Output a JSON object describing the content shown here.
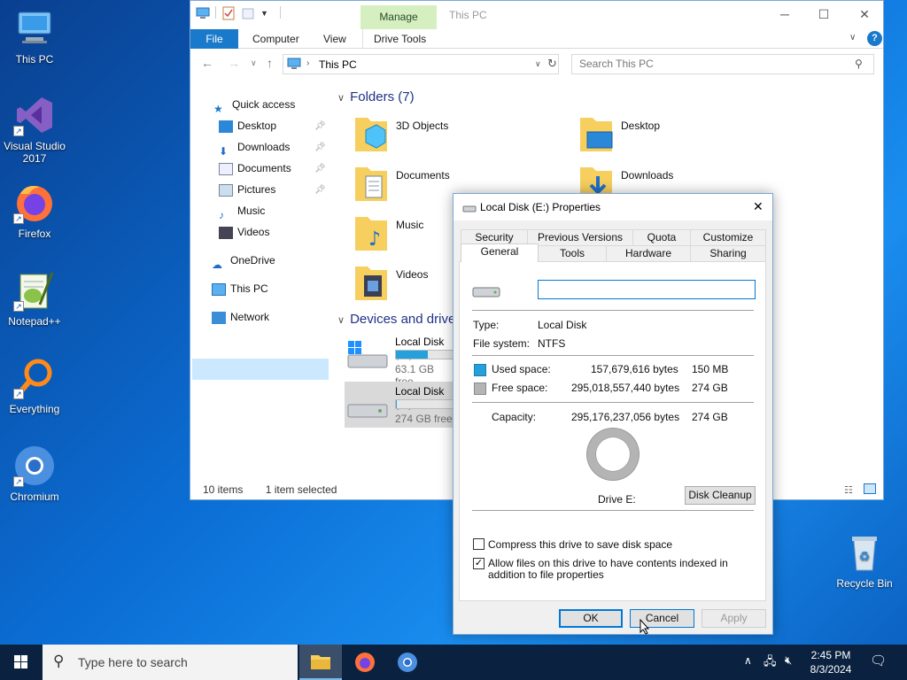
{
  "desktop": {
    "icons": [
      {
        "label": "This PC"
      },
      {
        "label": "Visual Studio 2017"
      },
      {
        "label": "Firefox"
      },
      {
        "label": "Notepad++"
      },
      {
        "label": "Everything"
      },
      {
        "label": "Chromium"
      }
    ],
    "recycle_bin": "Recycle Bin"
  },
  "explorer": {
    "title": "This PC",
    "manage_tab": "Manage",
    "ribbon_tabs": [
      "File",
      "Computer",
      "View",
      "Drive Tools"
    ],
    "address_path": "This PC",
    "search_placeholder": "Search This PC",
    "nav": {
      "quick_access": "Quick access",
      "items": [
        "Desktop",
        "Downloads",
        "Documents",
        "Pictures",
        "Music",
        "Videos"
      ],
      "onedrive": "OneDrive",
      "this_pc": "This PC",
      "network": "Network"
    },
    "folders_header": "Folders (7)",
    "folders": [
      "3D Objects",
      "Desktop",
      "Documents",
      "Downloads",
      "Music",
      "Videos"
    ],
    "devices_header": "Devices and drives",
    "drives": [
      {
        "name": "Local Disk (C:)",
        "free": "63.1 GB free",
        "used_fraction": 0.55
      },
      {
        "name": "Local Disk (E:)",
        "free": "274 GB free",
        "used_fraction": 0.0005
      }
    ],
    "status_items": "10 items",
    "status_selected": "1 item selected"
  },
  "dialog": {
    "title": "Local Disk (E:) Properties",
    "tabs_row1": [
      "Security",
      "Previous Versions",
      "Quota",
      "Customize"
    ],
    "tabs_row2": [
      "General",
      "Tools",
      "Hardware",
      "Sharing"
    ],
    "active_tab": "General",
    "label_value": "",
    "type_label": "Type:",
    "type_value": "Local Disk",
    "fs_label": "File system:",
    "fs_value": "NTFS",
    "used_label": "Used space:",
    "used_bytes": "157,679,616 bytes",
    "used_size": "150 MB",
    "free_label": "Free space:",
    "free_bytes": "295,018,557,440 bytes",
    "free_size": "274 GB",
    "capacity_label": "Capacity:",
    "capacity_bytes": "295,176,237,056 bytes",
    "capacity_size": "274 GB",
    "drive_label": "Drive E:",
    "disk_cleanup": "Disk Cleanup",
    "compress_label": "Compress this drive to save disk space",
    "compress_checked": false,
    "index_label": "Allow files on this drive to have contents indexed in addition to file properties",
    "index_checked": true,
    "ok": "OK",
    "cancel": "Cancel",
    "apply": "Apply",
    "colors": {
      "used": "#26a0da",
      "free": "#b4b4b4"
    }
  },
  "taskbar": {
    "search_placeholder": "Type here to search",
    "time": "2:45 PM",
    "date": "8/3/2024"
  }
}
